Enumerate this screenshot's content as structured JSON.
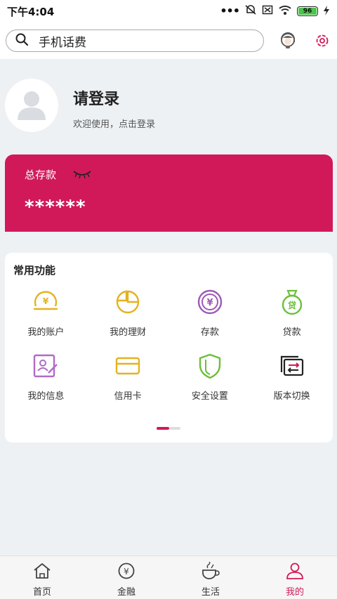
{
  "status_bar": {
    "time": "下午4:04",
    "battery": "96",
    "icons": [
      "more-dots-icon",
      "mute-icon",
      "sim-icon",
      "wifi-icon",
      "battery-icon",
      "charging-icon"
    ]
  },
  "header": {
    "search_text": "手机话费",
    "icons": [
      "search-icon",
      "customer-service-icon",
      "settings-icon"
    ]
  },
  "profile": {
    "title": "请登录",
    "subtitle": "欢迎使用，点击登录"
  },
  "deposit": {
    "label": "总存款",
    "amount": "******",
    "color": "#d1195a"
  },
  "functions": {
    "title": "常用功能",
    "items": [
      {
        "label": "我的账户",
        "icon": "account-icon",
        "color": "#e3b31f"
      },
      {
        "label": "我的理财",
        "icon": "pie-chart-icon",
        "color": "#e3b31f"
      },
      {
        "label": "存款",
        "icon": "deposit-coin-icon",
        "color": "#9b59b6"
      },
      {
        "label": "贷款",
        "icon": "loan-bag-icon",
        "color": "#6bbf3a"
      },
      {
        "label": "我的信息",
        "icon": "profile-card-icon",
        "color": "#b06ac7"
      },
      {
        "label": "信用卡",
        "icon": "credit-card-icon",
        "color": "#e3b31f"
      },
      {
        "label": "安全设置",
        "icon": "shield-icon",
        "color": "#6bbf3a"
      },
      {
        "label": "版本切换",
        "icon": "switch-icon",
        "color": "#222222"
      }
    ]
  },
  "tabbar": {
    "tabs": [
      {
        "label": "首页",
        "icon": "home-icon"
      },
      {
        "label": "金融",
        "icon": "finance-icon"
      },
      {
        "label": "生活",
        "icon": "life-cup-icon"
      },
      {
        "label": "我的",
        "icon": "user-icon"
      }
    ],
    "active_color": "#d1195a"
  }
}
